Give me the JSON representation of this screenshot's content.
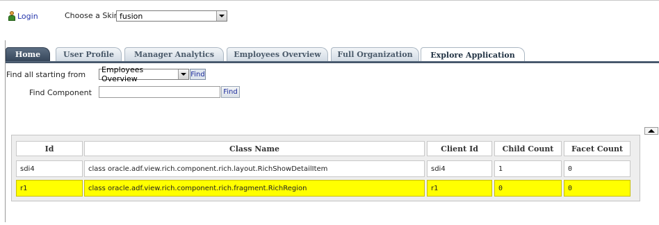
{
  "top": {
    "login": "Login",
    "skin_label": "Choose a Skin",
    "skin_value": "fusion"
  },
  "tabs": [
    {
      "label": "Home"
    },
    {
      "label": "User Profile"
    },
    {
      "label": "Manager Analytics"
    },
    {
      "label": "Employees Overview"
    },
    {
      "label": "Full Organization"
    },
    {
      "label": "Explore Application"
    }
  ],
  "active_tab": "Explore Application",
  "find": {
    "label_all": "Find all starting from",
    "select_value": "Employees Overview",
    "find_all_button": "Find",
    "label_component": "Find Component",
    "component_value": "",
    "find_button": "Find"
  },
  "table": {
    "headers": [
      "Id",
      "Class Name",
      "Client Id",
      "Child Count",
      "Facet Count"
    ],
    "rows": [
      {
        "id": "sdi4",
        "class_name": "class oracle.adf.view.rich.component.rich.layout.RichShowDetailItem",
        "client_id": "sdi4",
        "child_count": "1",
        "facet_count": "0",
        "selected": false
      },
      {
        "id": "r1",
        "class_name": "class oracle.adf.view.rich.component.rich.fragment.RichRegion",
        "client_id": "r1",
        "child_count": "0",
        "facet_count": "0",
        "selected": true
      }
    ]
  },
  "colors": {
    "selected_row": "#ffff00",
    "tab_dark": "#36465a",
    "link": "#2233aa"
  }
}
